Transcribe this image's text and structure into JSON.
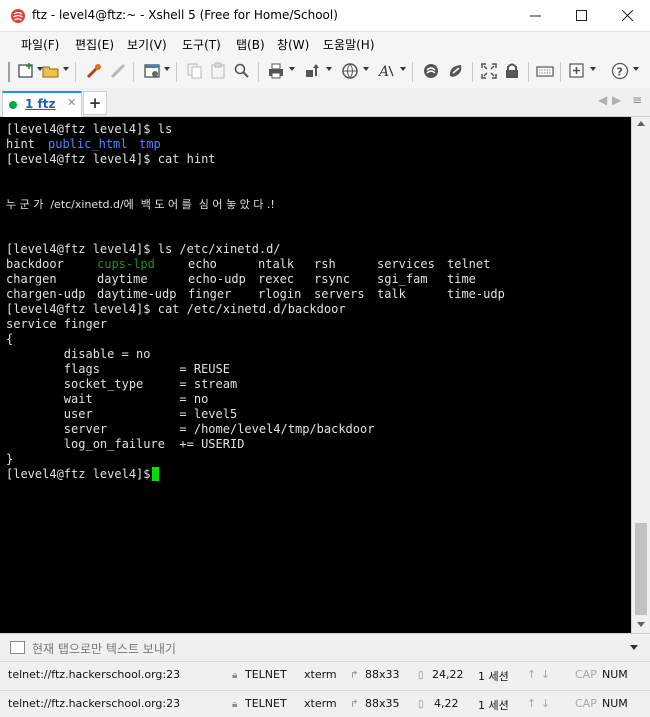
{
  "window": {
    "title": "ftz - level4@ftz:~ - Xshell 5 (Free for Home/School)",
    "controls": [
      "minimize-icon",
      "maximize-icon",
      "close-icon"
    ]
  },
  "menu": {
    "items": [
      "파일(F)",
      "편집(E)",
      "보기(V)",
      "도구(T)",
      "탭(B)",
      "창(W)",
      "도움말(H)"
    ]
  },
  "toolbar": {
    "icons": [
      "new-session-icon",
      "open-folder-icon",
      "properties-icon",
      "disconnect-icon",
      "new-tab-icon",
      "copy-icon",
      "paste-icon",
      "find-icon",
      "print-icon",
      "transfer-icon",
      "globe-icon",
      "font-icon",
      "xftp-icon",
      "xmanager-icon",
      "fullscreen-icon",
      "lock-icon",
      "keyboard-icon",
      "add-icon",
      "help-icon"
    ]
  },
  "tabs": [
    {
      "label": "1 ftz",
      "active": true,
      "status_color": "#00a848"
    }
  ],
  "terminal": {
    "prompt": "[level4@ftz level4]$",
    "lines": [
      "[level4@ftz level4]$ ls",
      "[level4@ftz level4]$ cat hint",
      "누 군 가  /etc/xinetd.d/에  백 도 어 를  심 어 놓 았 다 .!",
      "[level4@ftz level4]$ ls /etc/xinetd.d/",
      "[level4@ftz level4]$ cat /etc/xinetd.d/backdoor",
      "service finger",
      "{",
      "        disable = no",
      "        flags           = REUSE",
      "        socket_type     = stream",
      "        wait            = no",
      "        user            = level5",
      "        server          = /home/level4/tmp/backdoor",
      "        log_on_failure  += USERID",
      "}",
      "[level4@ftz level4]$ "
    ],
    "ls_home": [
      {
        "name": "hint",
        "color": "#e0e0e0"
      },
      {
        "name": "public_html",
        "color": "#4f86ff"
      },
      {
        "name": "tmp",
        "color": "#4f86ff"
      }
    ],
    "xinetd_listing": [
      [
        "backdoor",
        "cups-lpd",
        "echo",
        "ntalk",
        "rsh",
        "services",
        "telnet"
      ],
      [
        "chargen",
        "daytime",
        "echo-udp",
        "rexec",
        "rsync",
        "sgi_fam",
        "time"
      ],
      [
        "chargen-udp",
        "daytime-udp",
        "finger",
        "rlogin",
        "servers",
        "talk",
        "time-udp"
      ]
    ],
    "colors": {
      "background": "#000000",
      "foreground": "#e0e0e0",
      "directory": "#4f86ff",
      "dim_green": "#1f8b1f",
      "cursor": "#00e000"
    }
  },
  "compose_bar": {
    "placeholder": "현재 탭으로만 텍스트 보내기"
  },
  "status_bars": [
    {
      "address": "telnet://ftz.hackerschool.org:23",
      "protocol": "TELNET",
      "term": "xterm",
      "size": "88x33",
      "position": "24,22",
      "sessions": "1 세션",
      "caps": "CAP",
      "num": "NUM"
    },
    {
      "address": "telnet://ftz.hackerschool.org:23",
      "protocol": "TELNET",
      "term": "xterm",
      "size": "88x35",
      "position": "4,22",
      "sessions": "1 세션",
      "caps": "CAP",
      "num": "NUM"
    }
  ]
}
